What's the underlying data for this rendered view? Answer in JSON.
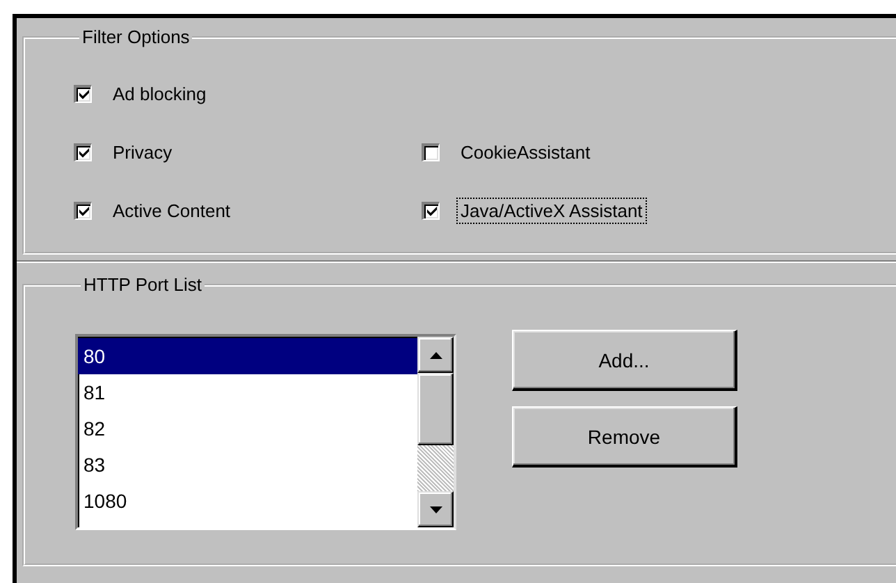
{
  "filter_options": {
    "title": "Filter Options",
    "rows": [
      {
        "checkboxes": [
          {
            "label": "Ad blocking",
            "checked": true,
            "focused": false
          }
        ]
      },
      {
        "checkboxes": [
          {
            "label": "Privacy",
            "checked": true,
            "focused": false
          },
          {
            "label": "CookieAssistant",
            "checked": false,
            "focused": false
          }
        ]
      },
      {
        "checkboxes": [
          {
            "label": "Active Content",
            "checked": true,
            "focused": false
          },
          {
            "label": "Java/ActiveX Assistant",
            "checked": true,
            "focused": true
          }
        ]
      }
    ]
  },
  "http_port_list": {
    "title": "HTTP Port List",
    "ports": [
      {
        "label": "80",
        "selected": true
      },
      {
        "label": "81",
        "selected": false
      },
      {
        "label": "82",
        "selected": false
      },
      {
        "label": "83",
        "selected": false
      },
      {
        "label": "1080",
        "selected": false
      }
    ],
    "buttons": [
      "Add...",
      "Remove"
    ]
  }
}
